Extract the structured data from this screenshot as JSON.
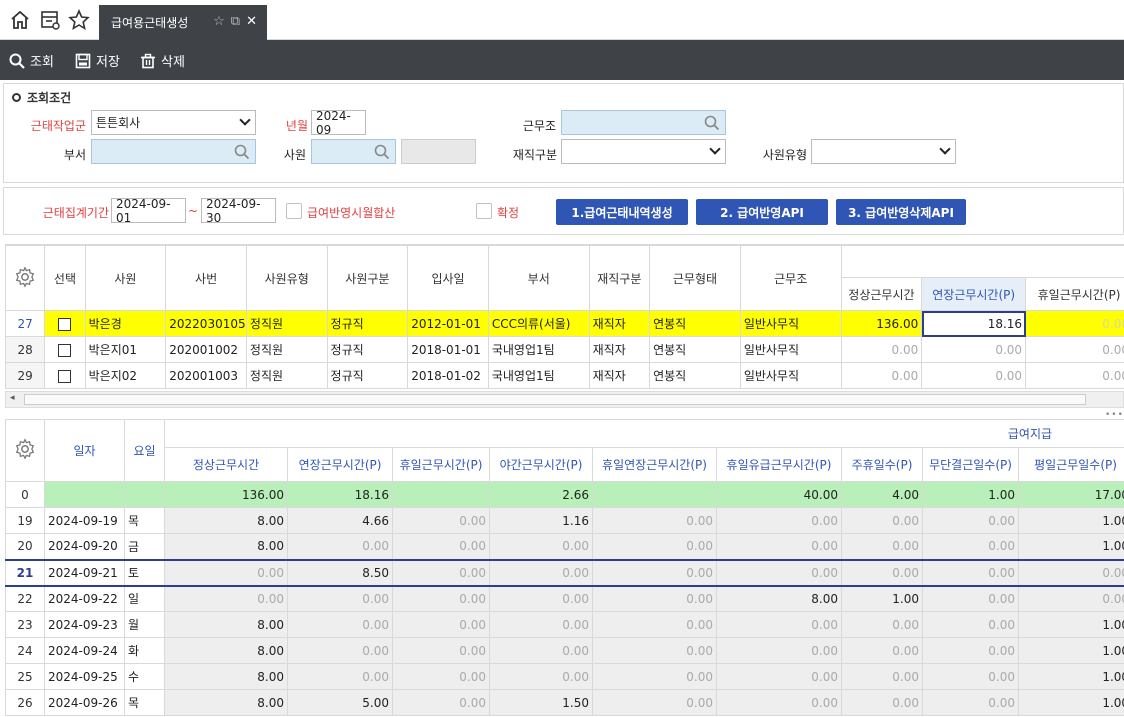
{
  "tabbar": {
    "active_tab_label": "급여용근태생성"
  },
  "toolbar": {
    "search_label": "조회",
    "save_label": "저장",
    "delete_label": "삭제"
  },
  "search_panel": {
    "title": "조회조건",
    "labels": {
      "work_group": "근태작업군",
      "year_month": "년월",
      "work_shift": "근무조",
      "department": "부서",
      "employee": "사원",
      "employment_status": "재직구분",
      "employee_type": "사원유형"
    },
    "values": {
      "work_group": "튼튼회사",
      "year_month": "2024-09",
      "work_shift": "",
      "department": "",
      "employee": "",
      "employment_status": "",
      "employee_type": ""
    }
  },
  "period_panel": {
    "period_label": "근태집계기간",
    "start_date": "2024-09-01",
    "tilde": "~",
    "end_date": "2024-09-30",
    "sum_on_payroll_label": "급여반영시월합산",
    "confirm_label": "확정",
    "btn1": "1.급여근태내역생성",
    "btn2": "2. 급여반영API",
    "btn3": "3. 급여반영삭제API"
  },
  "grid1": {
    "headers": [
      "선택",
      "사원",
      "사번",
      "사원유형",
      "사원구분",
      "입사일",
      "부서",
      "재직구분",
      "근무형태",
      "근무조",
      "정상근무시간",
      "연장근무시간(P)",
      "휴일근무시간(P)"
    ],
    "rows": [
      {
        "no": "27",
        "name": "박은경",
        "emp_no": "2022030105",
        "type": "정직원",
        "category": "정규직",
        "join_date": "2012-01-01",
        "dept": "CCC의류(서울)",
        "status": "재직자",
        "work_form": "연봉직",
        "shift": "일반사무직",
        "normal": "136.00",
        "overtime": "18.16",
        "holiday": "0.00"
      },
      {
        "no": "28",
        "name": "박은지01",
        "emp_no": "202001002",
        "type": "정직원",
        "category": "정규직",
        "join_date": "2018-01-01",
        "dept": "국내영업1팀",
        "status": "재직자",
        "work_form": "연봉직",
        "shift": "일반사무직",
        "normal": "0.00",
        "overtime": "0.00",
        "holiday": "0.00"
      },
      {
        "no": "29",
        "name": "박은지02",
        "emp_no": "202001003",
        "type": "정직원",
        "category": "정규직",
        "join_date": "2018-01-02",
        "dept": "국내영업1팀",
        "status": "재직자",
        "work_form": "연봉직",
        "shift": "일반사무직",
        "normal": "0.00",
        "overtime": "0.00",
        "holiday": "0.00"
      }
    ]
  },
  "grid2": {
    "group_header": "급여지급",
    "headers": [
      "일자",
      "요일",
      "정상근무시간",
      "연장근무시간(P)",
      "휴일근무시간(P)",
      "야간근무시간(P)",
      "휴일연장근무시간(P)",
      "휴일유급근무시간(P)",
      "주휴일수(P)",
      "무단결근일수(P)",
      "평일근무일수(P)"
    ],
    "rows": [
      {
        "no": "0",
        "date": "",
        "day": "",
        "v": [
          "136.00",
          "18.16",
          "",
          "2.66",
          "",
          "40.00",
          "4.00",
          "1.00",
          "17.00"
        ]
      },
      {
        "no": "19",
        "date": "2024-09-19",
        "day": "목",
        "v": [
          "8.00",
          "4.66",
          "0.00",
          "1.16",
          "0.00",
          "0.00",
          "0.00",
          "0.00",
          "1.00"
        ]
      },
      {
        "no": "20",
        "date": "2024-09-20",
        "day": "금",
        "v": [
          "8.00",
          "0.00",
          "0.00",
          "0.00",
          "0.00",
          "0.00",
          "0.00",
          "0.00",
          "1.00"
        ]
      },
      {
        "no": "21",
        "date": "2024-09-21",
        "day": "토",
        "v": [
          "0.00",
          "8.50",
          "0.00",
          "0.00",
          "0.00",
          "0.00",
          "0.00",
          "0.00",
          "0.00"
        ]
      },
      {
        "no": "22",
        "date": "2024-09-22",
        "day": "일",
        "v": [
          "0.00",
          "0.00",
          "0.00",
          "0.00",
          "0.00",
          "8.00",
          "1.00",
          "0.00",
          "0.00"
        ]
      },
      {
        "no": "23",
        "date": "2024-09-23",
        "day": "월",
        "v": [
          "8.00",
          "0.00",
          "0.00",
          "0.00",
          "0.00",
          "0.00",
          "0.00",
          "0.00",
          "1.00"
        ]
      },
      {
        "no": "24",
        "date": "2024-09-24",
        "day": "화",
        "v": [
          "8.00",
          "0.00",
          "0.00",
          "0.00",
          "0.00",
          "0.00",
          "0.00",
          "0.00",
          "1.00"
        ]
      },
      {
        "no": "25",
        "date": "2024-09-25",
        "day": "수",
        "v": [
          "8.00",
          "0.00",
          "0.00",
          "0.00",
          "0.00",
          "0.00",
          "0.00",
          "0.00",
          "1.00"
        ]
      },
      {
        "no": "26",
        "date": "2024-09-26",
        "day": "목",
        "v": [
          "8.00",
          "5.00",
          "0.00",
          "1.50",
          "0.00",
          "0.00",
          "0.00",
          "0.00",
          "1.00"
        ]
      }
    ]
  },
  "colors": {
    "toolbar_bg": "#3f4348",
    "primary_button": "#3056b5",
    "selected_row": "#ffff00",
    "summary_row": "#b9f0b9",
    "required_label": "#e04040"
  }
}
